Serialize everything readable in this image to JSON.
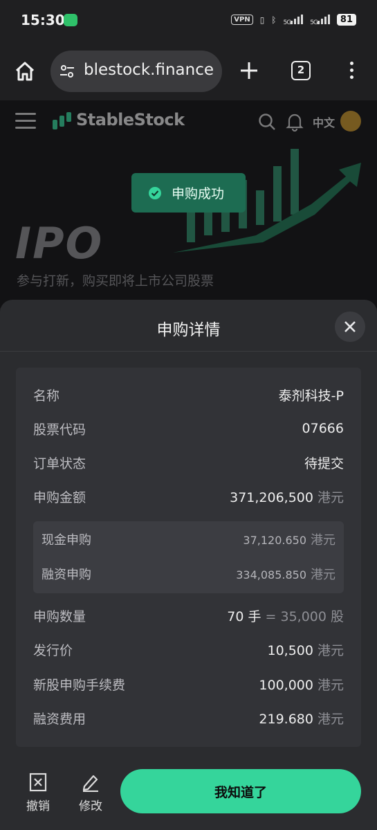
{
  "status_bar": {
    "time": "15:30",
    "vpn": "VPN",
    "net1": "5G",
    "net2": "5G",
    "battery": "81"
  },
  "browser": {
    "url": "stablestock.finance",
    "tab_count": "2"
  },
  "site": {
    "brand": "StableStock",
    "lang": "中文",
    "hero_title": "IPO",
    "hero_subtitle": "参与打新，购买即将上市公司股票"
  },
  "toast": {
    "text": "申购成功"
  },
  "sheet": {
    "title": "申购详情",
    "rows": [
      {
        "label": "名称",
        "value": "泰剂科技-P"
      },
      {
        "label": "股票代码",
        "value": "07666"
      },
      {
        "label": "订单状态",
        "value": "待提交"
      },
      {
        "label": "申购金额",
        "value": "371,206,500",
        "unit": "港元"
      }
    ],
    "sub_rows": [
      {
        "label": "现金申购",
        "value": "37,120.650",
        "unit": "港元"
      },
      {
        "label": "融资申购",
        "value": "334,085.850",
        "unit": "港元"
      }
    ],
    "qty": {
      "label": "申购数量",
      "lots": "70 手",
      "equals": "= 35,000 股"
    },
    "more_rows": [
      {
        "label": "发行价",
        "value": "10,500",
        "unit": "港元"
      },
      {
        "label": "新股申购手续费",
        "value": "100,000",
        "unit": "港元"
      },
      {
        "label": "融资费用",
        "value": "219.680",
        "unit": "港元"
      }
    ]
  },
  "footer": {
    "cancel": "撤销",
    "edit": "修改",
    "confirm": "我知道了"
  }
}
